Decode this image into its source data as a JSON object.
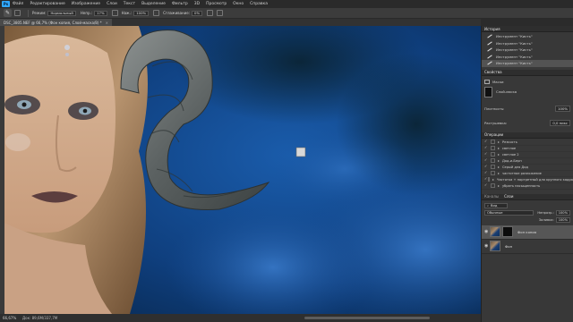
{
  "menubar": {
    "logo": "Ps",
    "items": [
      "Файл",
      "Редактирование",
      "Изображение",
      "Слои",
      "Текст",
      "Выделение",
      "Фильтр",
      "3D",
      "Просмотр",
      "Окно",
      "Справка"
    ]
  },
  "options_bar": {
    "mode_label": "Режим:",
    "mode_value": "Нормальный",
    "opacity_label": "Непр.:",
    "opacity_value": "17%",
    "flow_label": "Наж.:",
    "flow_value": "100%",
    "smoothing_label": "Сглаживание:",
    "smoothing_value": "0%"
  },
  "document_tab": {
    "title": "DSC_3805.NEF @ 66,7% (Фон копия, Слой-маска/8) *",
    "close": "×"
  },
  "statusbar": {
    "zoom": "66,67%",
    "doc_size": "Док: 89,6M/337,7M"
  },
  "history_panel": {
    "tab": "История",
    "items": [
      "Инструмент \"Кисть\"",
      "Инструмент \"Кисть\"",
      "Инструмент \"Кисть\"",
      "Инструмент \"Кисть\"",
      "Инструмент \"Кисть\""
    ],
    "active_index": 4
  },
  "properties_panel": {
    "tab": "Свойства",
    "kind": "Маски",
    "mask_label": "Слой-маска",
    "density_label": "Плотность:",
    "density_value": "100%",
    "feather_label": "Растушевка:",
    "feather_value": "0,0 пикс"
  },
  "actions_panel": {
    "tab": "Операции",
    "items": [
      "Резкость",
      "светлое",
      "светлое 2",
      "Дод-и-Берн",
      "Серый для Дод",
      "частотное разложение",
      "Частотка + портретный для крупного кадра",
      "убрать насыщенность"
    ]
  },
  "layers_panel": {
    "tabs": [
      "Каналы",
      "Слои"
    ],
    "filter_kind": "Вид",
    "blend_mode": "Обычные",
    "opacity_label": "Непрозр.:",
    "opacity_value": "100%",
    "fill_label": "Заливка:",
    "fill_value": "100%",
    "layers": [
      {
        "name": "Фон копия",
        "has_mask": true,
        "active": true
      },
      {
        "name": "Фон",
        "has_mask": false,
        "active": false
      }
    ]
  },
  "colors": {
    "background_blue": "#0e3a6e",
    "panel_bg": "#383838",
    "accent": "#31a8ff"
  }
}
